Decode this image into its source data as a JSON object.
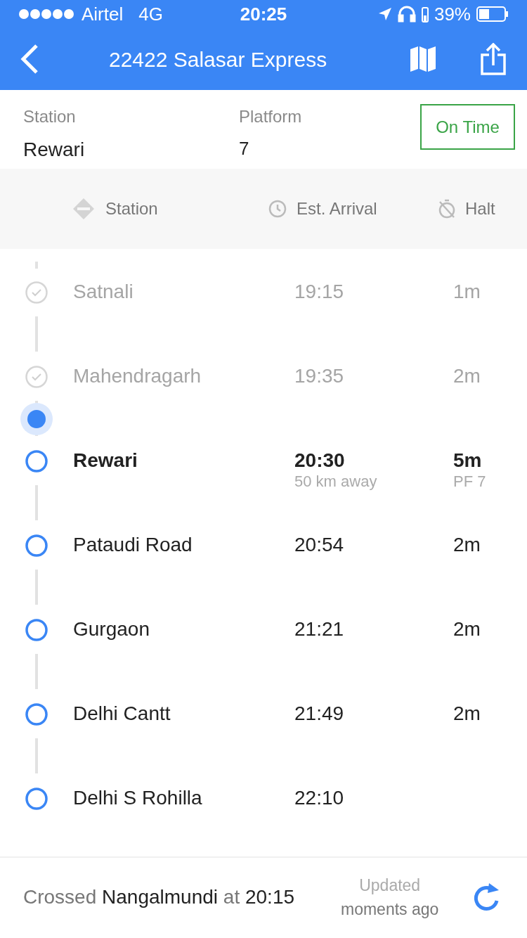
{
  "status_bar": {
    "carrier": "Airtel",
    "network": "4G",
    "time": "20:25",
    "battery": "39%"
  },
  "nav": {
    "title": "22422 Salasar Express"
  },
  "info": {
    "station_label": "Station",
    "station": "Rewari",
    "platform_label": "Platform",
    "platform": "7",
    "status": "On Time"
  },
  "columns": [
    "Station",
    "Est. Arrival",
    "Halt"
  ],
  "stations": [
    {
      "name": "Satnali",
      "arrival": "19:15",
      "halt": "1m",
      "kind": "passed",
      "train_approaching": false
    },
    {
      "name": "Mahendragarh",
      "arrival": "19:35",
      "halt": "2m",
      "kind": "passed",
      "train_approaching": false
    },
    {
      "name": "Rewari",
      "arrival": "20:30",
      "halt": "5m",
      "distance": "50 km away",
      "platform": "PF 7",
      "kind": "next",
      "train_approaching": true
    },
    {
      "name": "Pataudi Road",
      "arrival": "20:54",
      "halt": "2m",
      "kind": "upcoming",
      "train_approaching": false
    },
    {
      "name": "Gurgaon",
      "arrival": "21:21",
      "halt": "2m",
      "kind": "upcoming",
      "train_approaching": false
    },
    {
      "name": "Delhi Cantt",
      "arrival": "21:49",
      "halt": "2m",
      "kind": "upcoming",
      "train_approaching": false
    },
    {
      "name": "Delhi S Rohilla",
      "arrival": "22:10",
      "kind": "upcoming",
      "train_approaching": false
    }
  ],
  "footer": {
    "crossed": "Crossed **Nangalmundi** at **20:15**",
    "updated_label": "Updated",
    "updated_time": "moments ago"
  }
}
